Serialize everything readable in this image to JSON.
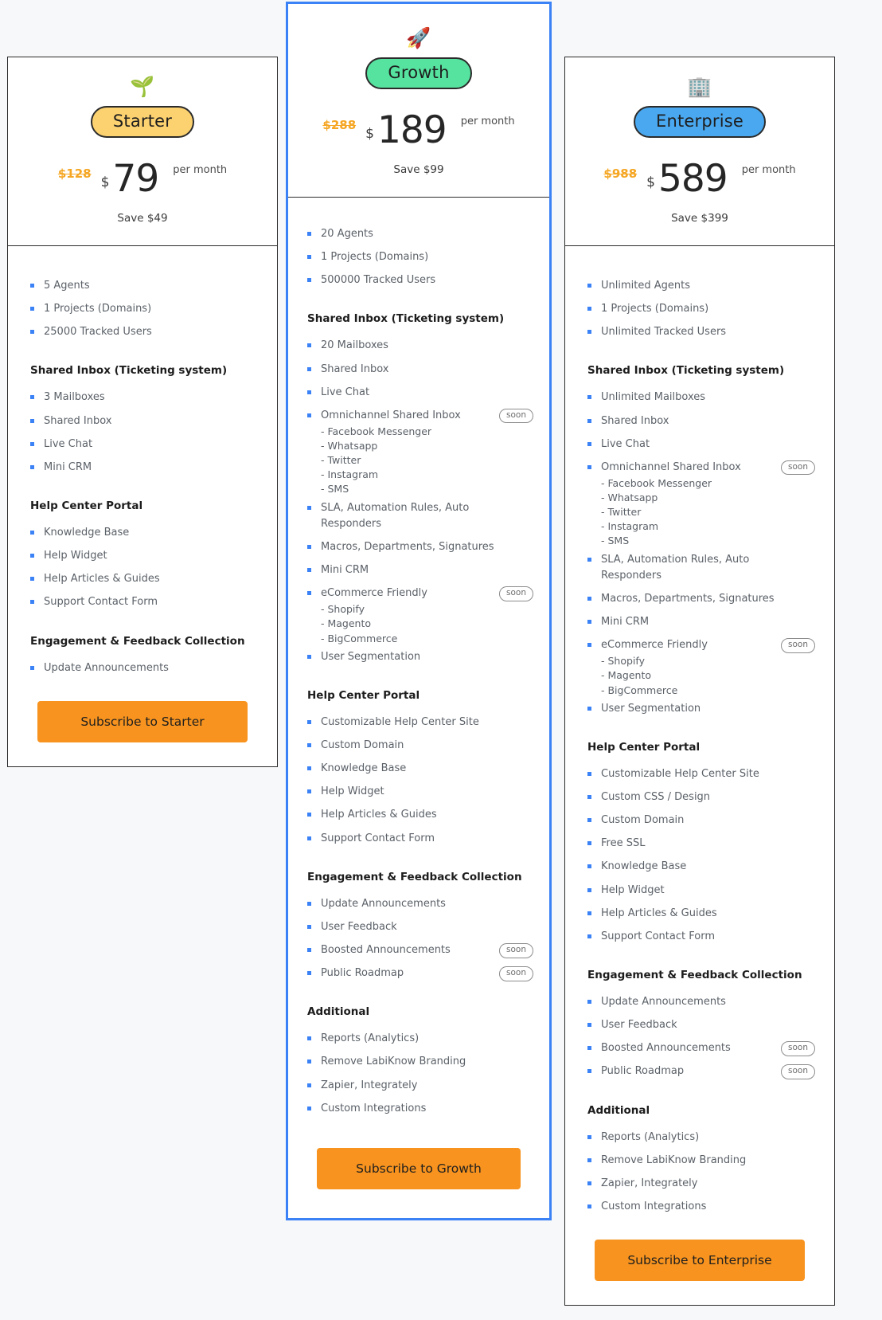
{
  "plans": [
    {
      "id": "starter",
      "emoji": "🌱",
      "emoji_name": "seedling-icon",
      "name": "Starter",
      "old_price": "$128",
      "currency": "$",
      "price": "79",
      "period": "per month",
      "save": "Save $49",
      "cta": "Subscribe to Starter",
      "pill_color": "#fcd270",
      "groups": [
        {
          "title": "",
          "features": [
            {
              "label": "5 Agents"
            },
            {
              "label": "1 Projects (Domains)"
            },
            {
              "label": "25000 Tracked Users"
            }
          ]
        },
        {
          "title": "Shared Inbox (Ticketing system)",
          "features": [
            {
              "label": "3 Mailboxes"
            },
            {
              "label": "Shared Inbox"
            },
            {
              "label": "Live Chat"
            },
            {
              "label": "Mini CRM"
            }
          ]
        },
        {
          "title": "Help Center Portal",
          "features": [
            {
              "label": "Knowledge Base"
            },
            {
              "label": "Help Widget"
            },
            {
              "label": "Help Articles & Guides"
            },
            {
              "label": "Support Contact Form"
            }
          ]
        },
        {
          "title": "Engagement & Feedback Collection",
          "features": [
            {
              "label": "Update Announcements"
            }
          ]
        }
      ]
    },
    {
      "id": "growth",
      "emoji": "🚀",
      "emoji_name": "rocket-icon",
      "name": "Growth",
      "old_price": "$288",
      "currency": "$",
      "price": "189",
      "period": "per month",
      "save": "Save $99",
      "cta": "Subscribe to Growth",
      "pill_color": "#56e39f",
      "groups": [
        {
          "title": "",
          "features": [
            {
              "label": "20 Agents"
            },
            {
              "label": "1 Projects (Domains)"
            },
            {
              "label": "500000 Tracked Users"
            }
          ]
        },
        {
          "title": "Shared Inbox (Ticketing system)",
          "features": [
            {
              "label": "20 Mailboxes"
            },
            {
              "label": "Shared Inbox"
            },
            {
              "label": "Live Chat"
            },
            {
              "label": "Omnichannel Shared Inbox",
              "badge": "soon",
              "sub": [
                "Facebook Messenger",
                "Whatsapp",
                "Twitter",
                "Instagram",
                "SMS"
              ]
            },
            {
              "label": "SLA, Automation Rules, Auto Responders"
            },
            {
              "label": "Macros, Departments, Signatures"
            },
            {
              "label": "Mini CRM"
            },
            {
              "label": "eCommerce Friendly",
              "badge": "soon",
              "sub": [
                "Shopify",
                "Magento",
                "BigCommerce"
              ]
            },
            {
              "label": "User Segmentation"
            }
          ]
        },
        {
          "title": "Help Center Portal",
          "features": [
            {
              "label": "Customizable Help Center Site"
            },
            {
              "label": "Custom Domain"
            },
            {
              "label": "Knowledge Base"
            },
            {
              "label": "Help Widget"
            },
            {
              "label": "Help Articles & Guides"
            },
            {
              "label": "Support Contact Form"
            }
          ]
        },
        {
          "title": "Engagement & Feedback Collection",
          "features": [
            {
              "label": "Update Announcements"
            },
            {
              "label": "User Feedback"
            },
            {
              "label": "Boosted Announcements",
              "badge": "soon"
            },
            {
              "label": "Public Roadmap",
              "badge": "soon"
            }
          ]
        },
        {
          "title": "Additional",
          "features": [
            {
              "label": "Reports (Analytics)"
            },
            {
              "label": "Remove LabiKnow Branding"
            },
            {
              "label": "Zapier, Integrately"
            },
            {
              "label": "Custom Integrations"
            }
          ]
        }
      ]
    },
    {
      "id": "enterprise",
      "emoji": "🏢",
      "emoji_name": "office-building-icon",
      "name": "Enterprise",
      "old_price": "$988",
      "currency": "$",
      "price": "589",
      "period": "per month",
      "save": "Save $399",
      "cta": "Subscribe to Enterprise",
      "pill_color": "#4aa8f0",
      "groups": [
        {
          "title": "",
          "features": [
            {
              "label": "Unlimited Agents"
            },
            {
              "label": "1 Projects (Domains)"
            },
            {
              "label": "Unlimited Tracked Users"
            }
          ]
        },
        {
          "title": "Shared Inbox (Ticketing system)",
          "features": [
            {
              "label": "Unlimited Mailboxes"
            },
            {
              "label": "Shared Inbox"
            },
            {
              "label": "Live Chat"
            },
            {
              "label": "Omnichannel Shared Inbox",
              "badge": "soon",
              "sub": [
                "Facebook Messenger",
                "Whatsapp",
                "Twitter",
                "Instagram",
                "SMS"
              ]
            },
            {
              "label": "SLA, Automation Rules, Auto Responders"
            },
            {
              "label": "Macros, Departments, Signatures"
            },
            {
              "label": "Mini CRM"
            },
            {
              "label": "eCommerce Friendly",
              "badge": "soon",
              "sub": [
                "Shopify",
                "Magento",
                "BigCommerce"
              ]
            },
            {
              "label": "User Segmentation"
            }
          ]
        },
        {
          "title": "Help Center Portal",
          "features": [
            {
              "label": "Customizable Help Center Site"
            },
            {
              "label": "Custom CSS / Design"
            },
            {
              "label": "Custom Domain"
            },
            {
              "label": "Free SSL"
            },
            {
              "label": "Knowledge Base"
            },
            {
              "label": "Help Widget"
            },
            {
              "label": "Help Articles & Guides"
            },
            {
              "label": "Support Contact Form"
            }
          ]
        },
        {
          "title": "Engagement & Feedback Collection",
          "features": [
            {
              "label": "Update Announcements"
            },
            {
              "label": "User Feedback"
            },
            {
              "label": "Boosted Announcements",
              "badge": "soon"
            },
            {
              "label": "Public Roadmap",
              "badge": "soon"
            }
          ]
        },
        {
          "title": "Additional",
          "features": [
            {
              "label": "Reports (Analytics)"
            },
            {
              "label": "Remove LabiKnow Branding"
            },
            {
              "label": "Zapier, Integrately"
            },
            {
              "label": "Custom Integrations"
            }
          ]
        }
      ]
    }
  ]
}
